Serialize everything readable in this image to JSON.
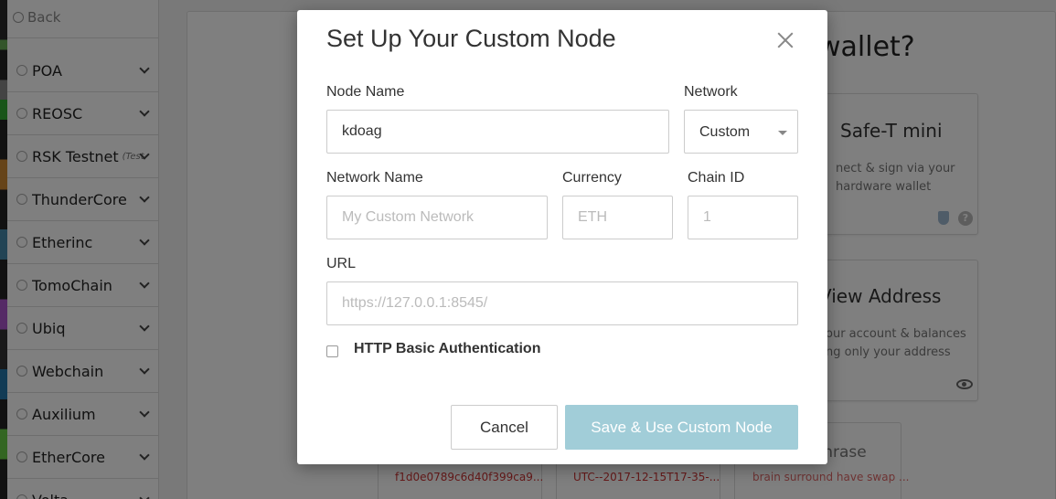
{
  "sidebar": {
    "back_label": "Back",
    "networks": [
      {
        "label": "POA",
        "tag": ""
      },
      {
        "label": "REOSC",
        "tag": ""
      },
      {
        "label": "RSK Testnet",
        "tag": "(Test"
      },
      {
        "label": "ThunderCore",
        "tag": ""
      },
      {
        "label": "Etherinc",
        "tag": ""
      },
      {
        "label": "TomoChain",
        "tag": ""
      },
      {
        "label": "Ubiq",
        "tag": ""
      },
      {
        "label": "Webchain",
        "tag": ""
      },
      {
        "label": "Auxilium",
        "tag": ""
      },
      {
        "label": "EtherCore",
        "tag": ""
      },
      {
        "label": "Volta",
        "tag": ""
      }
    ]
  },
  "background": {
    "heading_fragment": "wallet?",
    "hardware_card": {
      "title": "Safe-T mini",
      "desc_line1": "nect & sign via your",
      "desc_line2": "hardware wallet"
    },
    "view_card": {
      "title": "View Address",
      "desc_line1": "our account & balances",
      "desc_line2": "ng only your address"
    },
    "mini_cards": [
      {
        "hash": "f1d0e0789c6d40f399ca9..."
      },
      {
        "hash": "UTC--2017-12-15T17-35-..."
      }
    ],
    "phrase_title": "Phrase",
    "phrase_sub": "brain surround have swap ..."
  },
  "modal": {
    "title": "Set Up Your Custom Node",
    "node_name": {
      "label": "Node Name",
      "value": "kdoag"
    },
    "network": {
      "label": "Network",
      "selected": "Custom"
    },
    "network_name": {
      "label": "Network Name",
      "placeholder": "My Custom Network"
    },
    "currency": {
      "label": "Currency",
      "placeholder": "ETH"
    },
    "chain_id": {
      "label": "Chain ID",
      "placeholder": "1"
    },
    "url": {
      "label": "URL",
      "placeholder": "https://127.0.0.1:8545/"
    },
    "http_auth_label": "HTTP Basic Authentication",
    "cancel_label": "Cancel",
    "save_label": "Save & Use Custom Node"
  },
  "colors": {
    "save_button": "#a1cdd8",
    "overlay": "rgba(0,0,0,0.5)"
  }
}
